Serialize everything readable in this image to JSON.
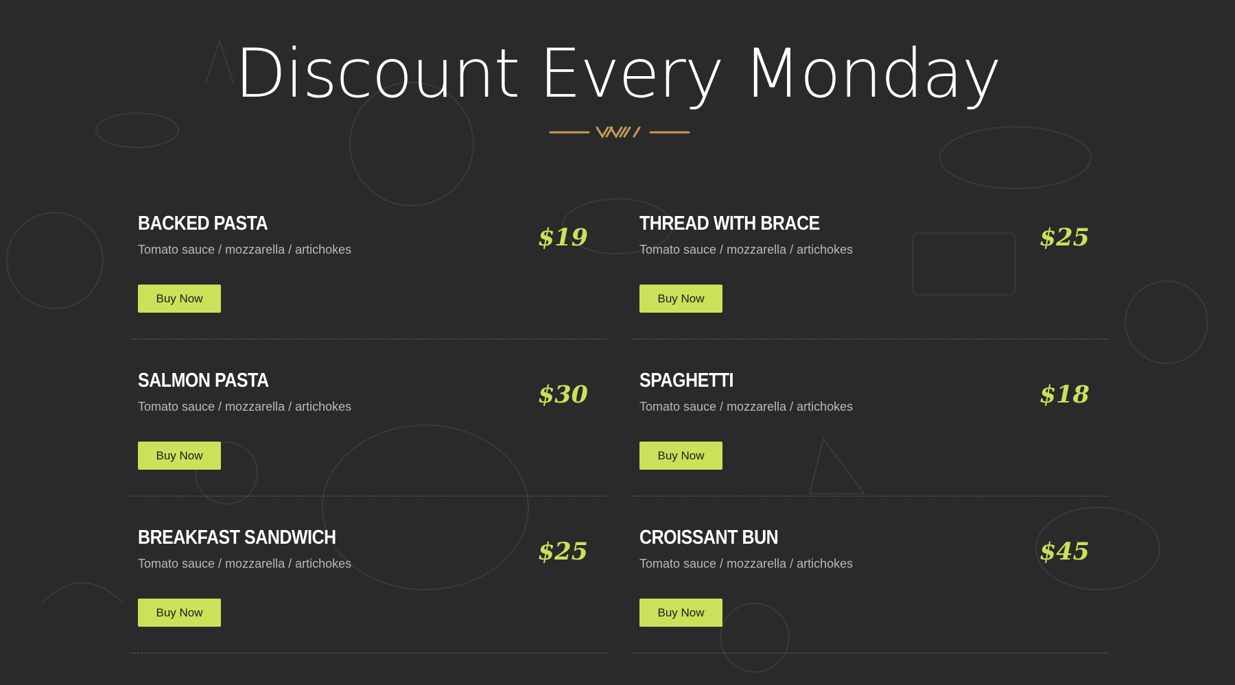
{
  "header": {
    "title": "Discount Every Monday"
  },
  "colors": {
    "background": "#2a2a2a",
    "accent": "#cde05a",
    "divider": "#c89a5a"
  },
  "menu": {
    "items": [
      {
        "name": "BACKED PASTA",
        "description": "Tomato sauce / mozzarella / artichokes",
        "price": "$19",
        "button_label": "Buy Now"
      },
      {
        "name": "THREAD WITH BRACE",
        "description": "Tomato sauce / mozzarella / artichokes",
        "price": "$25",
        "button_label": "Buy Now"
      },
      {
        "name": "SALMON PASTA",
        "description": "Tomato sauce / mozzarella / artichokes",
        "price": "$30",
        "button_label": "Buy Now"
      },
      {
        "name": "SPAGHETTI",
        "description": "Tomato sauce / mozzarella / artichokes",
        "price": "$18",
        "button_label": "Buy Now"
      },
      {
        "name": "BREAKFAST SANDWICH",
        "description": "Tomato sauce / mozzarella / artichokes",
        "price": "$25",
        "button_label": "Buy Now"
      },
      {
        "name": "CROISSANT BUN",
        "description": "Tomato sauce / mozzarella / artichokes",
        "price": "$45",
        "button_label": "Buy Now"
      }
    ]
  }
}
